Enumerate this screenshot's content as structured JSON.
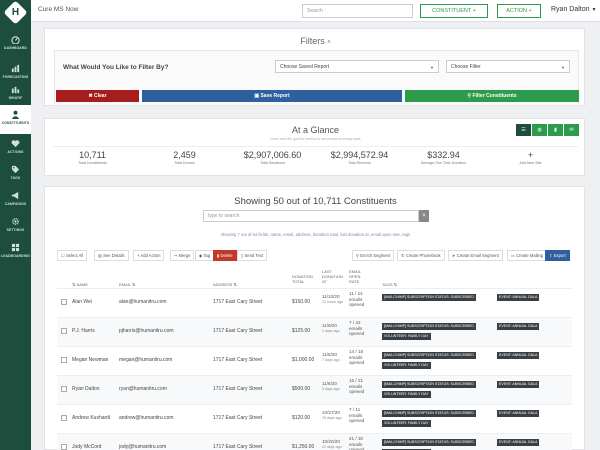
{
  "app": {
    "title": "Cure MS Now",
    "logo_letter": "H"
  },
  "topbar": {
    "search_placeholder": "Search",
    "constituent_btn": "CONSTITUENT +",
    "action_btn": "ACTION +",
    "user": "Ryan Dalton"
  },
  "sidebar": {
    "items": [
      {
        "label": "DASHBOARD",
        "icon": "dashboard-icon"
      },
      {
        "label": "FORECASTING",
        "icon": "forecast-icon"
      },
      {
        "label": "WHATIF",
        "icon": "whatif-icon"
      },
      {
        "label": "CONSTITUENTS",
        "icon": "user-icon"
      },
      {
        "label": "ACTIONS",
        "icon": "heart-icon"
      },
      {
        "label": "TAGS",
        "icon": "tag-icon"
      },
      {
        "label": "CAMPAIGNS",
        "icon": "megaphone-icon"
      },
      {
        "label": "SETTINGS",
        "icon": "gear-icon"
      },
      {
        "label": "LEADBOARDING",
        "icon": "grid-icon"
      }
    ]
  },
  "filters": {
    "title": "Filters",
    "prompt": "What Would You Like to Filter By?",
    "saved_report_value": "Choose Saved Report",
    "filter_value": "Choose Filter",
    "clear_label": "Clear",
    "save_report_label": "Save Report",
    "filter_constituents_label": "Filter Constituents"
  },
  "glance": {
    "title": "At a Glance",
    "subtitle": "hover over the gold for metrics to see people summary stats",
    "stats": [
      {
        "value": "10,711",
        "label": "Total Constituents"
      },
      {
        "value": "2,459",
        "label": "Total Donors"
      },
      {
        "value": "$2,907,006.60",
        "label": "Total Donations"
      },
      {
        "value": "$2,994,572.94",
        "label": "Total Revenue"
      },
      {
        "value": "$332.94",
        "label": "Average One Time Donation"
      },
      {
        "value": "+",
        "label": "Add New Stat"
      }
    ]
  },
  "list": {
    "title": "Showing 50 out of 10,711 Constituents",
    "search_placeholder": "type to search",
    "hint": "showing 7 out of 64 fields: name, email, address, donation total, last donation at, email open rate, tags",
    "toolbar": {
      "select_all": "Select All",
      "see_details": "See Details",
      "add_action": "Add Action",
      "merge": "Merge",
      "tag": "Tag",
      "delete": "Delete",
      "send_text": "Send Text",
      "enrich_segment": "Enrich Segment",
      "create_phonebook": "Create Phonebook",
      "create_email_segment": "Create Email Segment",
      "create_mailing": "Create Mailing",
      "export": "Export"
    },
    "headers": {
      "name": "NAME",
      "email": "EMAIL",
      "address": "ADDRESS",
      "donation_total_1": "DONATION",
      "donation_total_2": "TOTAL",
      "last_donation_1": "LAST",
      "last_donation_2": "DONATION",
      "last_donation_3": "AT",
      "email_open_1": "EMAIL",
      "email_open_2": "OPEN",
      "email_open_3": "RATE",
      "tags": "TAGS"
    },
    "rows": [
      {
        "name": "Alan Wei",
        "email": "alan@humanitru.com",
        "address": "1717 East Cary Street",
        "total": "$150.00",
        "last_date": "11/10/20",
        "last_ago": "23 hours ago",
        "open_1": "11 / 14",
        "open_2": "emails",
        "open_3": "opened",
        "tags": [
          "[MAILCHIMP] SUBSCRIPTION STATUS: SUBSCRIBED",
          "EVENT: ANNUAL GALA"
        ]
      },
      {
        "name": "P.J. Harris",
        "email": "pjharris@humanitru.com",
        "address": "1717 East Cary Street",
        "total": "$125.00",
        "last_date": "11/9/20",
        "last_ago": "2 days ago",
        "open_1": "7 / 42",
        "open_2": "emails",
        "open_3": "opened",
        "tags": [
          "[MAILCHIMP] SUBSCRIPTION STATUS: SUBSCRIBED",
          "EVENT: ANNUAL GALA",
          "VOLUNTEER: FAMILY DAY"
        ]
      },
      {
        "name": "Megan Newman",
        "email": "megan@humanitru.com",
        "address": "1717 East Cary Street",
        "total": "$1,000.00",
        "last_date": "11/5/20",
        "last_ago": "7 days ago",
        "open_1": "14 / 18",
        "open_2": "emails",
        "open_3": "opened",
        "tags": [
          "[MAILCHIMP] SUBSCRIPTION STATUS: SUBSCRIBED",
          "EVENT: ANNUAL GALA",
          "VOLUNTEER: FAMILY DAY"
        ]
      },
      {
        "name": "Ryan Dalton",
        "email": "ryan@humanitru.com",
        "address": "1717 East Cary Street",
        "total": "$500.00",
        "last_date": "11/6/20",
        "last_ago": "5 days ago",
        "open_1": "16 / 21",
        "open_2": "emails",
        "open_3": "opened",
        "tags": [
          "[MAILCHIMP] SUBSCRIPTION STATUS: SUBSCRIBED",
          "EVENT: ANNUAL GALA",
          "VOLUNTEER: FAMILY DAY"
        ]
      },
      {
        "name": "Andrew Kushardi",
        "email": "andrew@humanitru.com",
        "address": "1717 East Cary Street",
        "total": "$120.00",
        "last_date": "10/27/20",
        "last_ago": "15 days ago",
        "open_1": "7 / 11",
        "open_2": "emails",
        "open_3": "opened",
        "tags": [
          "[MAILCHIMP] SUBSCRIPTION STATUS: SUBSCRIBED",
          "EVENT: ANNUAL GALA",
          "VOLUNTEER: FAMILY DAY"
        ]
      },
      {
        "name": "Jody McCord",
        "email": "jody@humanitru.com",
        "address": "1717 East Cary Street",
        "total": "$1,250.00",
        "last_date": "10/20/20",
        "last_ago": "22 days ago",
        "open_1": "21 / 30",
        "open_2": "emails",
        "open_3": "opened",
        "tags": [
          "[MAILCHIMP] SUBSCRIPTION STATUS: SUBSCRIBED",
          "EVENT: ANNUAL GALA",
          "VOLUNTEER: FAMILY DAY"
        ]
      }
    ]
  },
  "colors": {
    "sidebar": "#1d4e3d",
    "green": "#2c9b4b",
    "red": "#a61d1d",
    "blue": "#2f5f9e",
    "tag": "#3a3f44"
  }
}
